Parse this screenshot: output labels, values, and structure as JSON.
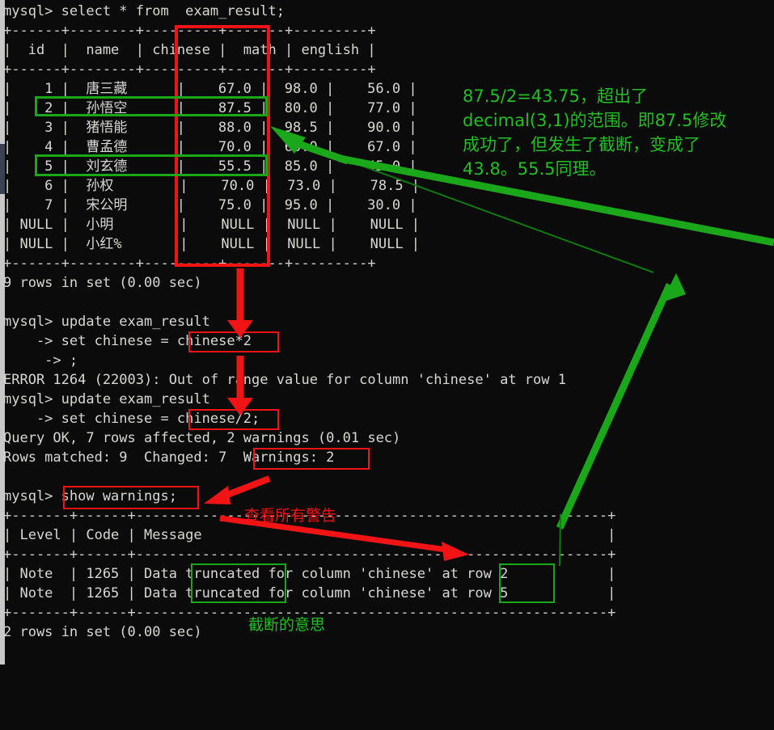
{
  "terminal": {
    "prompt_select": "mysql> select * from  exam_result;",
    "rule_top": "+------+--------+---------+-------+---------+",
    "header_row": "|  id  |  name  | chinese |  math | english |",
    "rule_mid": "+------+--------+---------+-------+---------+",
    "rows": [
      "|    1 |  唐三藏      |    67.0 |  98.0 |    56.0 |",
      "|    2 |  孙悟空      |    87.5 |  80.0 |    77.0 |",
      "|    3 |  猪悟能      |    88.0 |  98.5 |    90.0 |",
      "|    4 |  曹孟德      |    70.0 |  60.0 |    67.0 |",
      "|    5 |  刘玄德      |    55.5 |  85.0 |    45.0 |",
      "|    6 |  孙权        |    70.0 |  73.0 |    78.5 |",
      "|    7 |  宋公明      |    75.0 |  95.0 |    30.0 |",
      "| NULL |  小明        |    NULL |  NULL |    NULL |",
      "| NULL |  小红%       |    NULL |  NULL |    NULL |"
    ],
    "rule_bottom": "+------+--------+---------+-------+---------+",
    "rows_in_set_9": "9 rows in set (0.00 sec)",
    "prompt_update_1": "mysql> update exam_result",
    "cont_set_mul": "    -> set chinese = chinese*2",
    "cont_semicolon": "     -> ;",
    "error_line": "ERROR 1264 (22003): Out of range value for column 'chinese' at row 1",
    "prompt_update_2": "mysql> update exam_result",
    "cont_set_div": "    -> set chinese = chinese/2;",
    "query_ok": "Query OK, 7 rows affected, 2 warnings (0.01 sec)",
    "rows_matched": "Rows matched: 9  Changed: 7  Warnings: 2",
    "prompt_show_warnings": "mysql> show warnings;",
    "warn_rule_top": "+-------+------+---------------------------------------------------------+",
    "warn_header": "| Level | Code | Message                                                 |",
    "warn_rule_mid": "+-------+------+---------------------------------------------------------+",
    "warn_rows": [
      "| Note  | 1265 | Data truncated for column 'chinese' at row 2            |",
      "| Note  | 1265 | Data truncated for column 'chinese' at row 5            |"
    ],
    "warn_rule_bottom": "+-------+------+---------------------------------------------------------+",
    "rows_in_set_2": "2 rows in set (0.00 sec)"
  },
  "table": {
    "columns": [
      "id",
      "name",
      "chinese",
      "math",
      "english"
    ],
    "data": [
      {
        "id": "1",
        "name": "唐三藏",
        "chinese": "67.0",
        "math": "98.0",
        "english": "56.0"
      },
      {
        "id": "2",
        "name": "孙悟空",
        "chinese": "87.5",
        "math": "80.0",
        "english": "77.0"
      },
      {
        "id": "3",
        "name": "猪悟能",
        "chinese": "88.0",
        "math": "98.5",
        "english": "90.0"
      },
      {
        "id": "4",
        "name": "曹孟德",
        "chinese": "70.0",
        "math": "60.0",
        "english": "67.0"
      },
      {
        "id": "5",
        "name": "刘玄德",
        "chinese": "55.5",
        "math": "85.0",
        "english": "45.0"
      },
      {
        "id": "6",
        "name": "孙权",
        "chinese": "70.0",
        "math": "73.0",
        "english": "78.5"
      },
      {
        "id": "7",
        "name": "宋公明",
        "chinese": "75.0",
        "math": "95.0",
        "english": "30.0"
      },
      {
        "id": "NULL",
        "name": "小明",
        "chinese": "NULL",
        "math": "NULL",
        "english": "NULL"
      },
      {
        "id": "NULL",
        "name": "小红%",
        "chinese": "NULL",
        "math": "NULL",
        "english": "NULL"
      }
    ]
  },
  "warnings_table": {
    "columns": [
      "Level",
      "Code",
      "Message"
    ],
    "data": [
      {
        "level": "Note",
        "code": "1265",
        "message": "Data truncated for column 'chinese' at row 2"
      },
      {
        "level": "Note",
        "code": "1265",
        "message": "Data truncated for column 'chinese' at row 5"
      }
    ]
  },
  "annotations": {
    "green_note": "87.5/2=43.75，超出了\ndecimal(3,1)的范围。即87.5修改\n成功了，但发生了截断，变成了\n43.8。55.5同理。",
    "red_note_show_warnings": "查看所有警告",
    "green_note_truncated": "截断的意思"
  },
  "colors": {
    "background": "#0b0b0b",
    "terminal_text": "#e6e6e1",
    "annotation_green": "#1fc01f",
    "annotation_red": "#f01010",
    "highlight_red": "#f21414",
    "highlight_green": "#18a818",
    "scrollbar": "#c8c8c8"
  }
}
